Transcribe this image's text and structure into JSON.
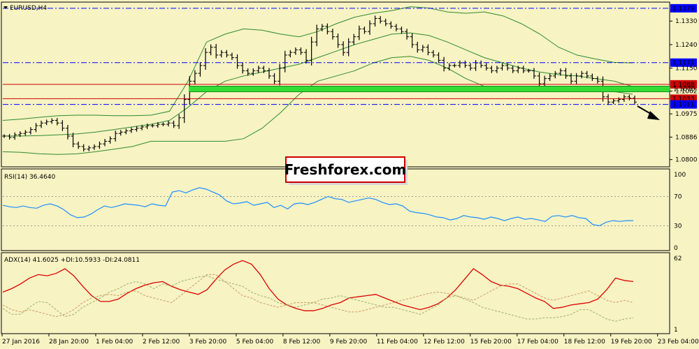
{
  "symbol_title": "EURUSD,H4",
  "watermark": "Freshforex.com",
  "colors": {
    "background": "#f7f3c3",
    "frame": "#000000",
    "price_bars": "#000000",
    "bollinger": "#2e8b2e",
    "support_zone": "#33dd33",
    "red_levels": "#cc0000",
    "blue_levels": "#0000ff",
    "rsi_line": "#1e8fff",
    "adx_main": "#dd0000",
    "plus_di": "#9ab06a",
    "minus_di": "#cc9966",
    "watermark_bg": "#ffffff",
    "watermark_border": "#cc0000"
  },
  "chart_data": [
    {
      "panel": "price",
      "type": "ohlc",
      "instrument": "EURUSD",
      "timeframe": "H4",
      "ylim": [
        1.0775,
        1.14
      ],
      "y_ticks": [
        "1.1330",
        "1.1240",
        "1.1150",
        "1.1062",
        "1.0975",
        "1.0886",
        "1.0800"
      ],
      "x_ticks": [
        "27 Jan 2016",
        "28 Jan 20:00",
        "1 Feb 04:00",
        "2 Feb 12:00",
        "3 Feb 20:00",
        "5 Feb 04:00",
        "8 Feb 12:00",
        "9 Feb 20:00",
        "11 Feb 04:00",
        "12 Feb 12:00",
        "15 Feb 20:00",
        "17 Feb 04:00",
        "18 Feb 12:00",
        "19 Feb 20:00",
        "23 Feb 04:00"
      ],
      "close": [
        1.089,
        1.0885,
        1.0895,
        1.09,
        1.0905,
        1.0915,
        1.093,
        1.094,
        1.0945,
        1.095,
        1.094,
        1.092,
        1.089,
        1.086,
        1.085,
        1.084,
        1.0845,
        1.085,
        1.086,
        1.087,
        1.088,
        1.09,
        1.0905,
        1.091,
        1.0915,
        1.092,
        1.0925,
        1.093,
        1.093,
        1.0935,
        1.0935,
        1.094,
        1.093,
        1.096,
        1.103,
        1.11,
        1.113,
        1.116,
        1.121,
        1.123,
        1.12,
        1.121,
        1.12,
        1.119,
        1.116,
        1.114,
        1.113,
        1.114,
        1.115,
        1.114,
        1.112,
        1.11,
        1.115,
        1.12,
        1.121,
        1.122,
        1.121,
        1.118,
        1.125,
        1.13,
        1.131,
        1.129,
        1.127,
        1.124,
        1.121,
        1.125,
        1.127,
        1.13,
        1.129,
        1.132,
        1.134,
        1.133,
        1.132,
        1.131,
        1.13,
        1.129,
        1.127,
        1.124,
        1.122,
        1.123,
        1.121,
        1.12,
        1.118,
        1.115,
        1.116,
        1.116,
        1.117,
        1.116,
        1.115,
        1.117,
        1.116,
        1.115,
        1.114,
        1.115,
        1.116,
        1.115,
        1.114,
        1.115,
        1.114,
        1.114,
        1.112,
        1.109,
        1.111,
        1.112,
        1.113,
        1.114,
        1.112,
        1.11,
        1.112,
        1.113,
        1.112,
        1.111,
        1.11,
        1.104,
        1.102,
        1.1025,
        1.103,
        1.104,
        1.1035,
        1.102
      ],
      "bollinger": {
        "upper": [
          1.095,
          1.0955,
          1.0962,
          1.0968,
          1.097,
          1.097,
          1.0968,
          1.0968,
          1.097,
          1.0985,
          1.11,
          1.125,
          1.128,
          1.13,
          1.1295,
          1.128,
          1.127,
          1.129,
          1.132,
          1.1345,
          1.136,
          1.137,
          1.1385,
          1.138,
          1.1365,
          1.136,
          1.1365,
          1.135,
          1.132,
          1.128,
          1.123,
          1.12,
          1.1185,
          1.1172,
          1.117
        ],
        "middle": [
          1.089,
          1.089,
          1.0892,
          1.0895,
          1.0898,
          1.0905,
          1.0915,
          1.0925,
          1.0935,
          1.095,
          1.1,
          1.106,
          1.11,
          1.112,
          1.1135,
          1.115,
          1.1165,
          1.119,
          1.1215,
          1.124,
          1.126,
          1.128,
          1.1285,
          1.1275,
          1.125,
          1.122,
          1.119,
          1.117,
          1.115,
          1.1135,
          1.1125,
          1.112,
          1.111,
          1.11,
          1.108
        ],
        "lower": [
          1.083,
          1.0828,
          1.0822,
          1.082,
          1.0822,
          1.083,
          1.084,
          1.085,
          1.087,
          1.087,
          1.087,
          1.087,
          1.087,
          1.088,
          1.092,
          1.098,
          1.105,
          1.11,
          1.112,
          1.114,
          1.117,
          1.119,
          1.1195,
          1.118,
          1.115,
          1.111,
          1.108,
          1.1075,
          1.1075,
          1.108,
          1.108,
          1.1075,
          1.107,
          1.106,
          1.105
        ]
      },
      "horizontal_levels": [
        {
          "price": 1.1379,
          "label": "1.1379",
          "color": "blue",
          "style": "dash-dot"
        },
        {
          "price": 1.1171,
          "label": "1.1171",
          "color": "blue",
          "style": "dash-dot"
        },
        {
          "price": 1.1088,
          "label": "1.1088",
          "color": "red",
          "style": "solid"
        },
        {
          "price": 1.107,
          "label": "1.1070",
          "color": "green-zone",
          "style": "thick"
        },
        {
          "price": 1.1033,
          "label": "1.1033",
          "color": "red",
          "style": "solid"
        },
        {
          "price": 1.1011,
          "label": "1.1011",
          "color": "blue",
          "style": "dash-dot"
        }
      ],
      "annotation": "downward arrow"
    },
    {
      "panel": "rsi",
      "type": "line",
      "label": "RSI(14) 36.4640",
      "ylim": [
        0,
        100
      ],
      "y_ticks": [
        "100",
        "70",
        "30",
        "0"
      ],
      "levels": [
        70,
        30
      ],
      "values": [
        58,
        56,
        55,
        57,
        55,
        54,
        58,
        60,
        57,
        52,
        45,
        41,
        42,
        46,
        52,
        57,
        55,
        57,
        60,
        59,
        58,
        56,
        60,
        58,
        57,
        76,
        78,
        75,
        79,
        82,
        80,
        76,
        72,
        64,
        60,
        61,
        63,
        58,
        60,
        62,
        55,
        58,
        53,
        60,
        61,
        59,
        62,
        66,
        70,
        67,
        66,
        62,
        64,
        66,
        68,
        66,
        62,
        59,
        60,
        57,
        50,
        48,
        47,
        45,
        42,
        41,
        38,
        40,
        44,
        42,
        41,
        39,
        42,
        40,
        37,
        40,
        42,
        39,
        40,
        38,
        36,
        43,
        44,
        42,
        44,
        41,
        40,
        32,
        30,
        35,
        37,
        36,
        37,
        37
      ]
    },
    {
      "panel": "adx",
      "type": "line",
      "label": "ADX(14) 41.6025 +DI:10.5933 -DI:24.0811",
      "ylim": [
        1,
        62
      ],
      "y_ticks": [
        "62",
        "1"
      ],
      "series": [
        {
          "name": "ADX(14)",
          "values": [
            33,
            36,
            40,
            45,
            48,
            47,
            49,
            53,
            47,
            38,
            30,
            25,
            25,
            27,
            32,
            36,
            39,
            41,
            42,
            38,
            35,
            33,
            31,
            35,
            44,
            52,
            57,
            60,
            57,
            48,
            36,
            27,
            22,
            19,
            17,
            17,
            19,
            22,
            24,
            28,
            29,
            30,
            31,
            28,
            25,
            22,
            20,
            18,
            20,
            23,
            28,
            35,
            44,
            53,
            48,
            42,
            39,
            38,
            36,
            32,
            28,
            25,
            19,
            20,
            22,
            23,
            24,
            27,
            35,
            45,
            43,
            42
          ]
        },
        {
          "name": "+DI",
          "values": [
            19,
            14,
            14,
            20,
            25,
            24,
            18,
            12,
            14,
            20,
            24,
            28,
            33,
            36,
            40,
            42,
            40,
            36,
            40,
            38,
            42,
            44,
            46,
            47,
            44,
            42,
            40,
            38,
            33,
            30,
            28,
            24,
            22,
            20,
            22,
            24,
            27,
            28,
            30,
            28,
            26,
            24,
            22,
            20,
            20,
            18,
            16,
            14,
            18,
            22,
            28,
            30,
            27,
            24,
            20,
            18,
            16,
            14,
            12,
            10,
            10,
            11,
            11,
            12,
            14,
            18,
            18,
            14,
            10,
            8,
            10,
            11
          ]
        },
        {
          "name": "-DI",
          "values": [
            22,
            18,
            16,
            18,
            16,
            14,
            12,
            14,
            18,
            24,
            28,
            30,
            31,
            30,
            33,
            34,
            30,
            28,
            26,
            24,
            30,
            36,
            42,
            48,
            48,
            42,
            36,
            30,
            28,
            24,
            22,
            20,
            22,
            24,
            24,
            24,
            22,
            20,
            18,
            16,
            16,
            18,
            20,
            22,
            24,
            26,
            28,
            30,
            32,
            33,
            32,
            30,
            28,
            26,
            30,
            34,
            38,
            40,
            40,
            36,
            32,
            28,
            26,
            28,
            30,
            32,
            34,
            30,
            26,
            24,
            26,
            24
          ]
        }
      ]
    }
  ]
}
